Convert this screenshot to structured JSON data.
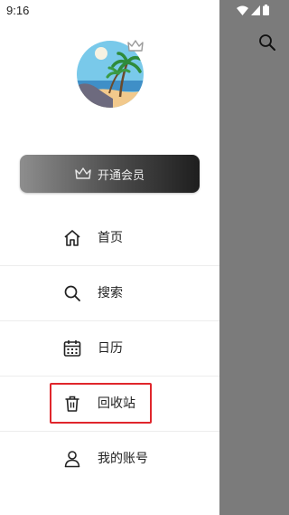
{
  "status_bar": {
    "time": "9:16"
  },
  "vip_button": {
    "label": "开通会员"
  },
  "menu": {
    "items": [
      {
        "label": "首页",
        "icon": "home-icon"
      },
      {
        "label": "搜索",
        "icon": "search-icon"
      },
      {
        "label": "日历",
        "icon": "calendar-icon"
      },
      {
        "label": "回收站",
        "icon": "trash-icon"
      },
      {
        "label": "我的账号",
        "icon": "user-icon"
      }
    ]
  },
  "colors": {
    "highlight": "#e0262c",
    "scrim": "#7b7b7b"
  }
}
